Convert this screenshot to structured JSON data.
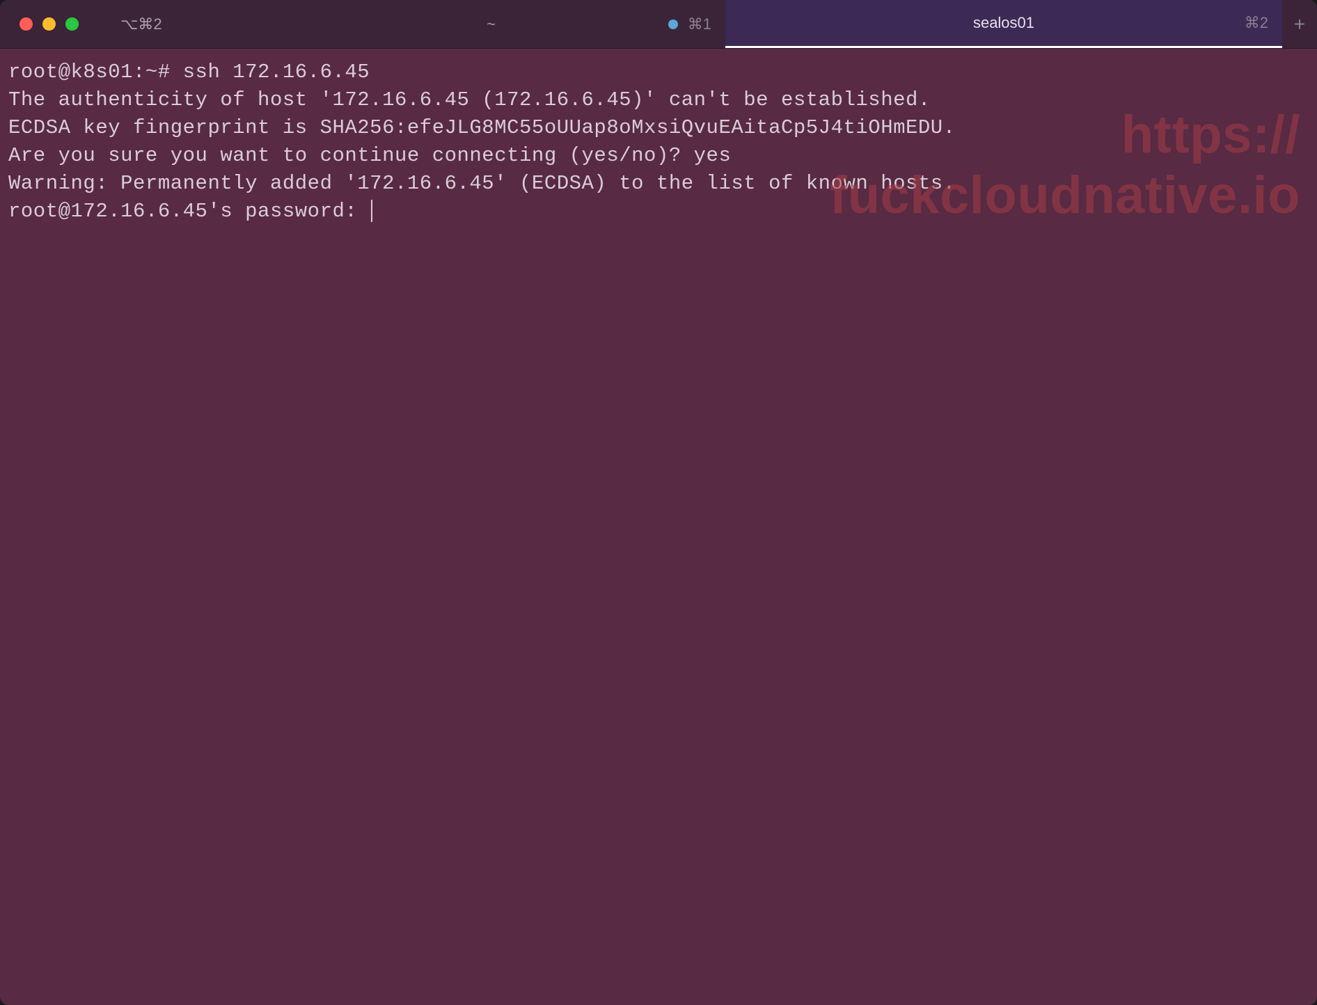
{
  "titlebar": {
    "tabs": [
      {
        "label": "⌥⌘2",
        "shortcut": ""
      },
      {
        "label": "~",
        "shortcut": "⌘1",
        "has_dot": true
      },
      {
        "label": "sealos01",
        "shortcut": "⌘2",
        "active": true
      }
    ],
    "add_label": "+"
  },
  "terminal": {
    "lines": [
      "root@k8s01:~# ssh 172.16.6.45",
      "The authenticity of host '172.16.6.45 (172.16.6.45)' can't be established.",
      "ECDSA key fingerprint is SHA256:efeJLG8MC55oUUap8oMxsiQvuEAitaCp5J4tiOHmEDU.",
      "Are you sure you want to continue connecting (yes/no)? yes",
      "Warning: Permanently added '172.16.6.45' (ECDSA) to the list of known hosts.",
      "root@172.16.6.45's password: "
    ]
  },
  "watermark": {
    "line1": "https://",
    "line2": "fuckcloudnative.io"
  }
}
